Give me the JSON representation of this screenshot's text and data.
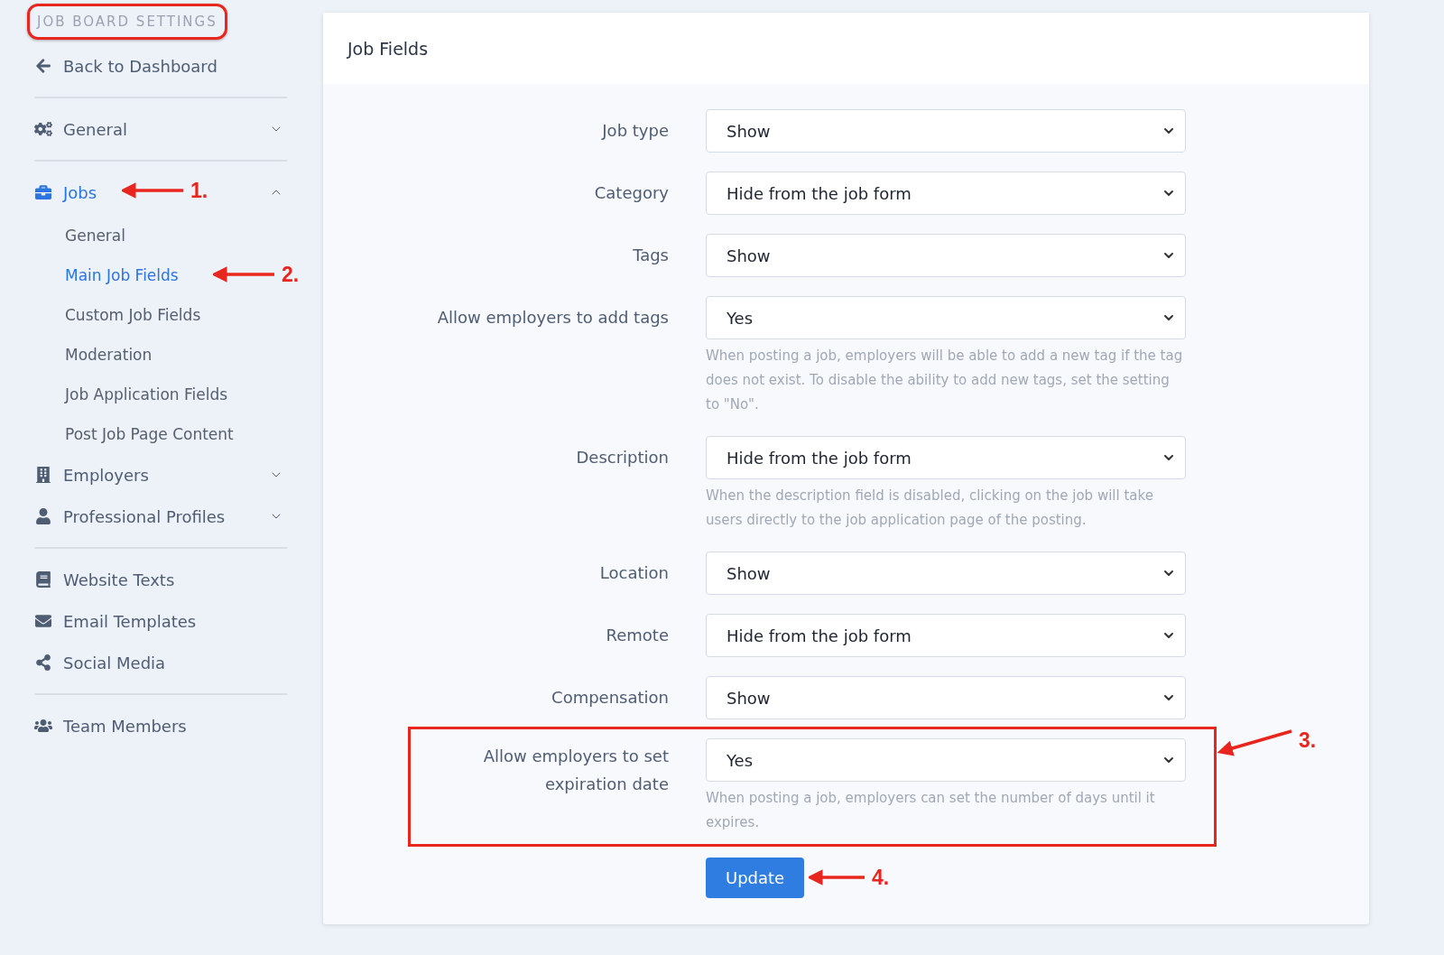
{
  "sidebar": {
    "title": "JOB BOARD SETTINGS",
    "title_highlighted": true,
    "groups": [
      [
        {
          "kind": "link",
          "label": "Back to Dashboard",
          "selected": false
        }
      ],
      [
        {
          "kind": "section",
          "label": "General",
          "selected": false,
          "expanded": false
        }
      ],
      [
        {
          "kind": "section",
          "label": "Jobs",
          "selected": true,
          "expanded": true,
          "children": [
            {
              "label": "General",
              "selected": false
            },
            {
              "label": "Main Job Fields",
              "selected": true
            },
            {
              "label": "Custom Job Fields",
              "selected": false
            },
            {
              "label": "Moderation",
              "selected": false
            },
            {
              "label": "Job Application Fields",
              "selected": false
            },
            {
              "label": "Post Job Page Content",
              "selected": false
            }
          ]
        },
        {
          "kind": "section",
          "label": "Employers",
          "selected": false,
          "expanded": false
        },
        {
          "kind": "section",
          "label": "Professional Profiles",
          "selected": false,
          "expanded": false
        }
      ],
      [
        {
          "kind": "link",
          "label": "Website Texts",
          "selected": false
        },
        {
          "kind": "link",
          "label": "Email Templates",
          "selected": false
        },
        {
          "kind": "link",
          "label": "Social Media",
          "selected": false
        }
      ],
      [
        {
          "kind": "link",
          "label": "Team Members",
          "selected": false
        }
      ]
    ]
  },
  "card": {
    "title": "Job Fields",
    "fields": [
      {
        "label": "Job type",
        "value": "Show",
        "highlighted": false
      },
      {
        "label": "Category",
        "value": "Hide from the job form",
        "highlighted": false
      },
      {
        "label": "Tags",
        "value": "Show",
        "highlighted": false
      },
      {
        "label": "Allow employers to add tags",
        "value": "Yes",
        "help": "When posting a job, employers will be able to add a new tag if the tag does not exist. To disable the ability to add new tags, set the setting to \"No\".",
        "highlighted": false
      },
      {
        "label": "Description",
        "value": "Hide from the job form",
        "help": "When the description field is disabled, clicking on the job will take users directly to the job application page of the posting.",
        "highlighted": false
      },
      {
        "label": "Location",
        "value": "Show",
        "highlighted": false
      },
      {
        "label": "Remote",
        "value": "Hide from the job form",
        "highlighted": false
      },
      {
        "label": "Compensation",
        "value": "Show",
        "highlighted": false
      },
      {
        "label": "Allow employers to set expiration date",
        "value": "Yes",
        "help": "When posting a job, employers can set the number of days until it expires.",
        "highlighted": true
      }
    ],
    "submit": "Update"
  },
  "annotations": [
    {
      "label": "1."
    },
    {
      "label": "2."
    },
    {
      "label": "3."
    },
    {
      "label": "4."
    }
  ]
}
